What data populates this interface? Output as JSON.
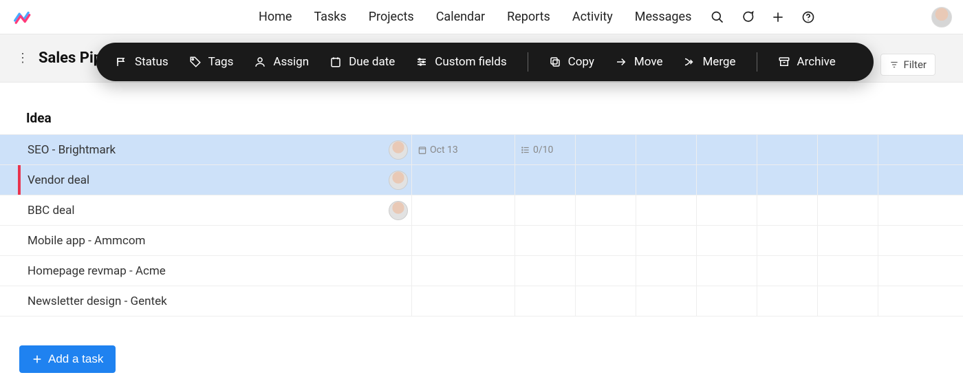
{
  "nav": {
    "items": [
      "Home",
      "Tasks",
      "Projects",
      "Calendar",
      "Reports",
      "Activity",
      "Messages"
    ]
  },
  "project": {
    "title": "Sales Pip"
  },
  "action_bar": {
    "status": "Status",
    "tags": "Tags",
    "assign": "Assign",
    "due": "Due date",
    "custom": "Custom fields",
    "copy": "Copy",
    "move": "Move",
    "merge": "Merge",
    "archive": "Archive"
  },
  "filter_label": "Filter",
  "section": {
    "title": "Idea"
  },
  "tasks": [
    {
      "name": "SEO - Brightmark",
      "selected": true,
      "has_assignee": true,
      "date": "Oct 13",
      "checklist": "0/10",
      "priority": null
    },
    {
      "name": "Vendor deal",
      "selected": true,
      "has_assignee": true,
      "date": null,
      "checklist": null,
      "priority": "red"
    },
    {
      "name": "BBC deal",
      "selected": false,
      "has_assignee": true,
      "date": null,
      "checklist": null,
      "priority": null
    },
    {
      "name": "Mobile app - Ammcom",
      "selected": false,
      "has_assignee": false,
      "date": null,
      "checklist": null,
      "priority": null
    },
    {
      "name": "Homepage revmap - Acme",
      "selected": false,
      "has_assignee": false,
      "date": null,
      "checklist": null,
      "priority": null
    },
    {
      "name": "Newsletter design - Gentek",
      "selected": false,
      "has_assignee": false,
      "date": null,
      "checklist": null,
      "priority": null
    }
  ],
  "add_task_label": "Add a task"
}
